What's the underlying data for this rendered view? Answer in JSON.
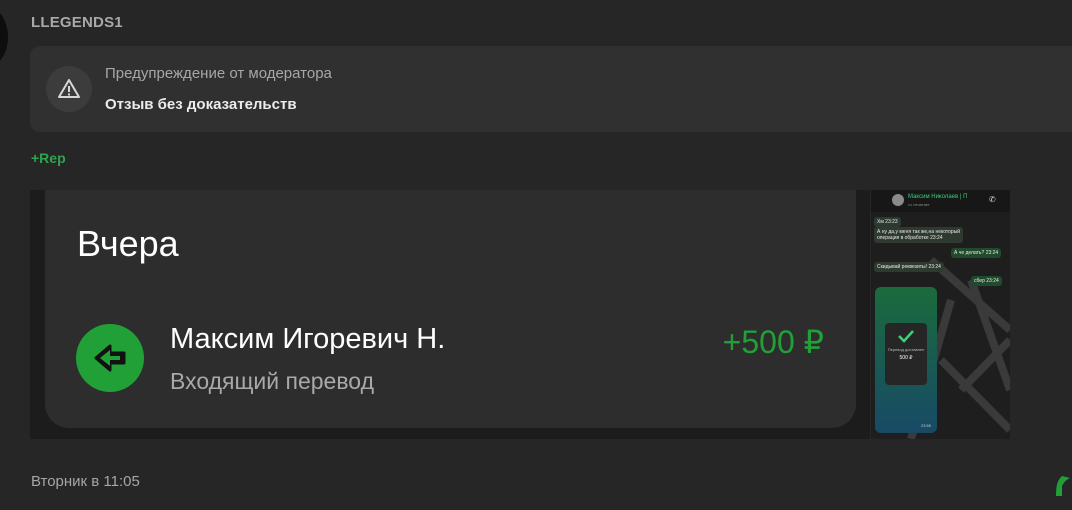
{
  "post": {
    "author": "LLEGENDS1",
    "timestamp": "Вторник в 11:05",
    "rep_label": "+Rep"
  },
  "moderator_warning": {
    "title": "Предупреждение от модератора",
    "text": "Отзыв без доказательств"
  },
  "attachment_main": {
    "day": "Вчера",
    "transaction": {
      "name": "Максим Игоревич Н.",
      "type": "Входящий перевод",
      "amount": "+500 ₽"
    },
    "colors": {
      "accent": "#21a038"
    }
  },
  "attachment_thumb": {
    "contact": "Максим Николаев | П",
    "status": "••• печатает",
    "messages": [
      {
        "text": "Хм",
        "time": "23:23"
      },
      {
        "text": "А ну да,у меня так же,на некоторый",
        "time": ""
      },
      {
        "text": "операция в обработке",
        "time": "23:24"
      },
      {
        "text": "А че делать?",
        "time": "23:24"
      },
      {
        "text": "Скидывай реквезиты!",
        "time": "23:24"
      },
      {
        "text": "сбер",
        "time": "23:24"
      }
    ],
    "payment_label": "Перевод доставлен",
    "payment_amount": "500 ₽",
    "screenshot_time": "23:55"
  },
  "icons": {
    "warning": "warning-triangle-icon",
    "incoming": "arrow-left-icon",
    "corner": "green-quote-icon"
  }
}
